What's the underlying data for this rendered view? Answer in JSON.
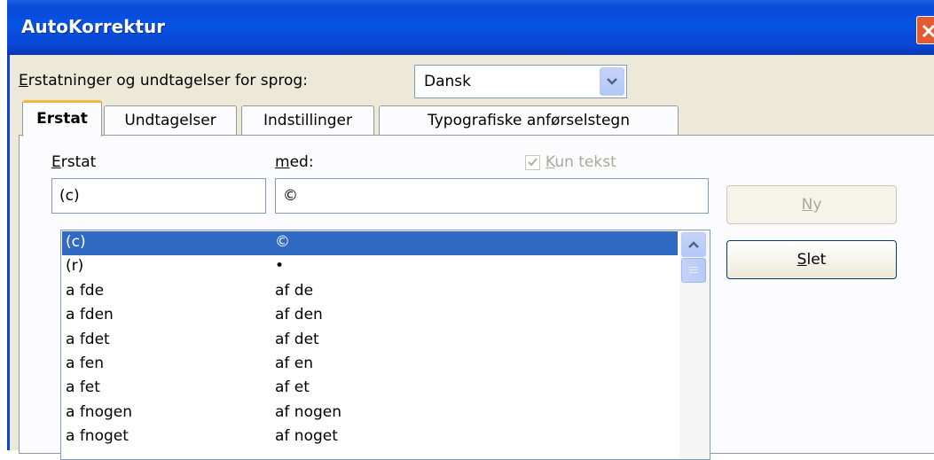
{
  "window": {
    "title": "AutoKorrektur"
  },
  "language": {
    "label": "Erstatninger og undtagelser for sprog:",
    "selected": "Dansk"
  },
  "tabs": [
    {
      "label": "Erstat",
      "active": true
    },
    {
      "label": "Undtagelser",
      "active": false
    },
    {
      "label": "Indstillinger",
      "active": false
    },
    {
      "label": "Typografiske anførselstegn",
      "active": false
    }
  ],
  "replace": {
    "replace_label": "Erstat",
    "with_label": "med:",
    "text_only_label": "Kun tekst",
    "text_only_checked": true,
    "replace_value": "(c)",
    "with_value": "©",
    "new_button": "Ny",
    "delete_button": "Slet",
    "list": [
      {
        "from": "(c)",
        "to": "©",
        "selected": true
      },
      {
        "from": "(r)",
        "to": "•"
      },
      {
        "from": "a fde",
        "to": "af de"
      },
      {
        "from": "a fden",
        "to": "af den"
      },
      {
        "from": "a fdet",
        "to": "af det"
      },
      {
        "from": "a fen",
        "to": "af en"
      },
      {
        "from": "a fet",
        "to": "af et"
      },
      {
        "from": "a fnogen",
        "to": "af nogen"
      },
      {
        "from": "a fnoget",
        "to": "af noget"
      }
    ]
  },
  "colors": {
    "titlebar": "#0a4ad8",
    "selection": "#316ac5",
    "active_tab_accent": "#f8b640",
    "dialog_bg": "#ece9d8"
  }
}
